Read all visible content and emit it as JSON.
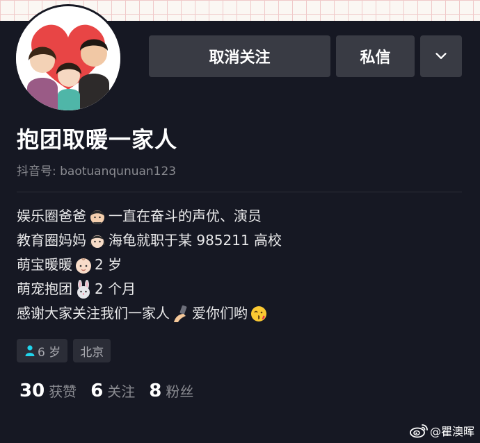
{
  "header": {
    "unfollow_label": "取消关注",
    "message_label": "私信"
  },
  "profile": {
    "name": "抱团取暖一家人",
    "douyin_id": "抖音号: baotuanqunuan123"
  },
  "bio": {
    "line1_a": "娱乐圈爸爸",
    "line1_b": "一直在奋斗的声优、演员",
    "line2_a": "教育圈妈妈",
    "line2_b": "海龟就职于某 985211 高校",
    "line3_a": "萌宝暖暖",
    "line3_b": "2 岁",
    "line4_a": "萌宠抱团",
    "line4_b": "2 个月",
    "line5_a": "感谢大家关注我们一家人",
    "line5_b": "爱你们哟"
  },
  "tags": {
    "age": "6 岁",
    "city": "北京"
  },
  "stats": {
    "likes_num": "30",
    "likes_label": "获赞",
    "following_num": "6",
    "following_label": "关注",
    "followers_num": "8",
    "followers_label": "粉丝"
  },
  "watermark": {
    "text": "@瞿澳晖"
  },
  "colors": {
    "background": "#161823",
    "button": "#393b44",
    "tag": "#2b2d37",
    "muted_text": "#8a8b91",
    "gender_icon": "#20d5ec"
  },
  "icons": {
    "more": "chevron-down-icon",
    "gender": "male-person-icon",
    "watermark": "weibo-icon"
  }
}
